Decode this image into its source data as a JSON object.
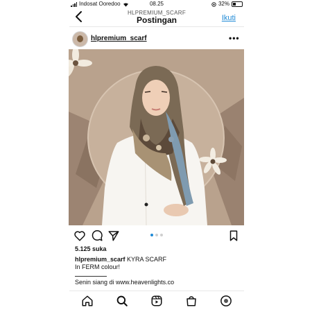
{
  "status_bar": {
    "carrier": "Indosat Ooredoo",
    "time": "08.25",
    "battery": "32%"
  },
  "header": {
    "account": "HLPREMIUM_SCARF",
    "title": "Postingan",
    "follow_label": "Ikuti"
  },
  "post": {
    "username": "hlpremium_scarf",
    "likes": "5.125 suka",
    "caption_user": "hlpremium_scarf",
    "caption_text": " KYRA SCARF",
    "caption_line2": "In FERM colour!",
    "caption_line3": "Senin siang di www.heavenlights.co",
    "carousel": {
      "total": 3,
      "active": 1
    }
  },
  "icons": {
    "back": "chevron-left-icon",
    "more": "more-horizontal-icon",
    "like": "heart-icon",
    "comment": "comment-icon",
    "share": "send-icon",
    "save": "bookmark-icon",
    "nav": [
      "home-icon",
      "search-icon",
      "reels-icon",
      "shop-icon",
      "profile-icon"
    ]
  },
  "colors": {
    "accent": "#1f8ad6",
    "photo_background": "#b7a08c"
  }
}
